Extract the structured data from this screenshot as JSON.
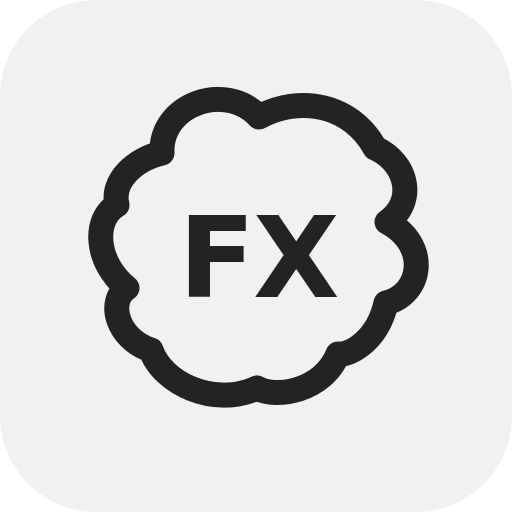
{
  "icon": {
    "label": "FX",
    "name": "flower-badge-icon",
    "colors": {
      "background": "#f1f1f1",
      "foreground": "#232323"
    }
  }
}
